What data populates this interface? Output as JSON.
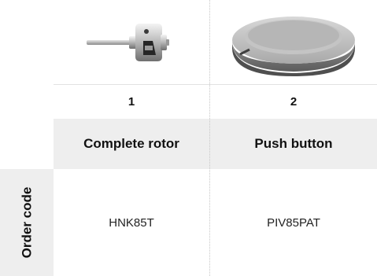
{
  "columns": [
    {
      "number": "1",
      "name": "Complete rotor",
      "order_code": "HNK85T",
      "image_icon": "rotor-part-icon"
    },
    {
      "number": "2",
      "name": "Push button",
      "order_code": "PIV85PAT",
      "image_icon": "push-button-part-icon"
    }
  ],
  "row_label": "Order code",
  "colors": {
    "header_background": "#eeeeee",
    "divider": "#c6c6c6"
  }
}
